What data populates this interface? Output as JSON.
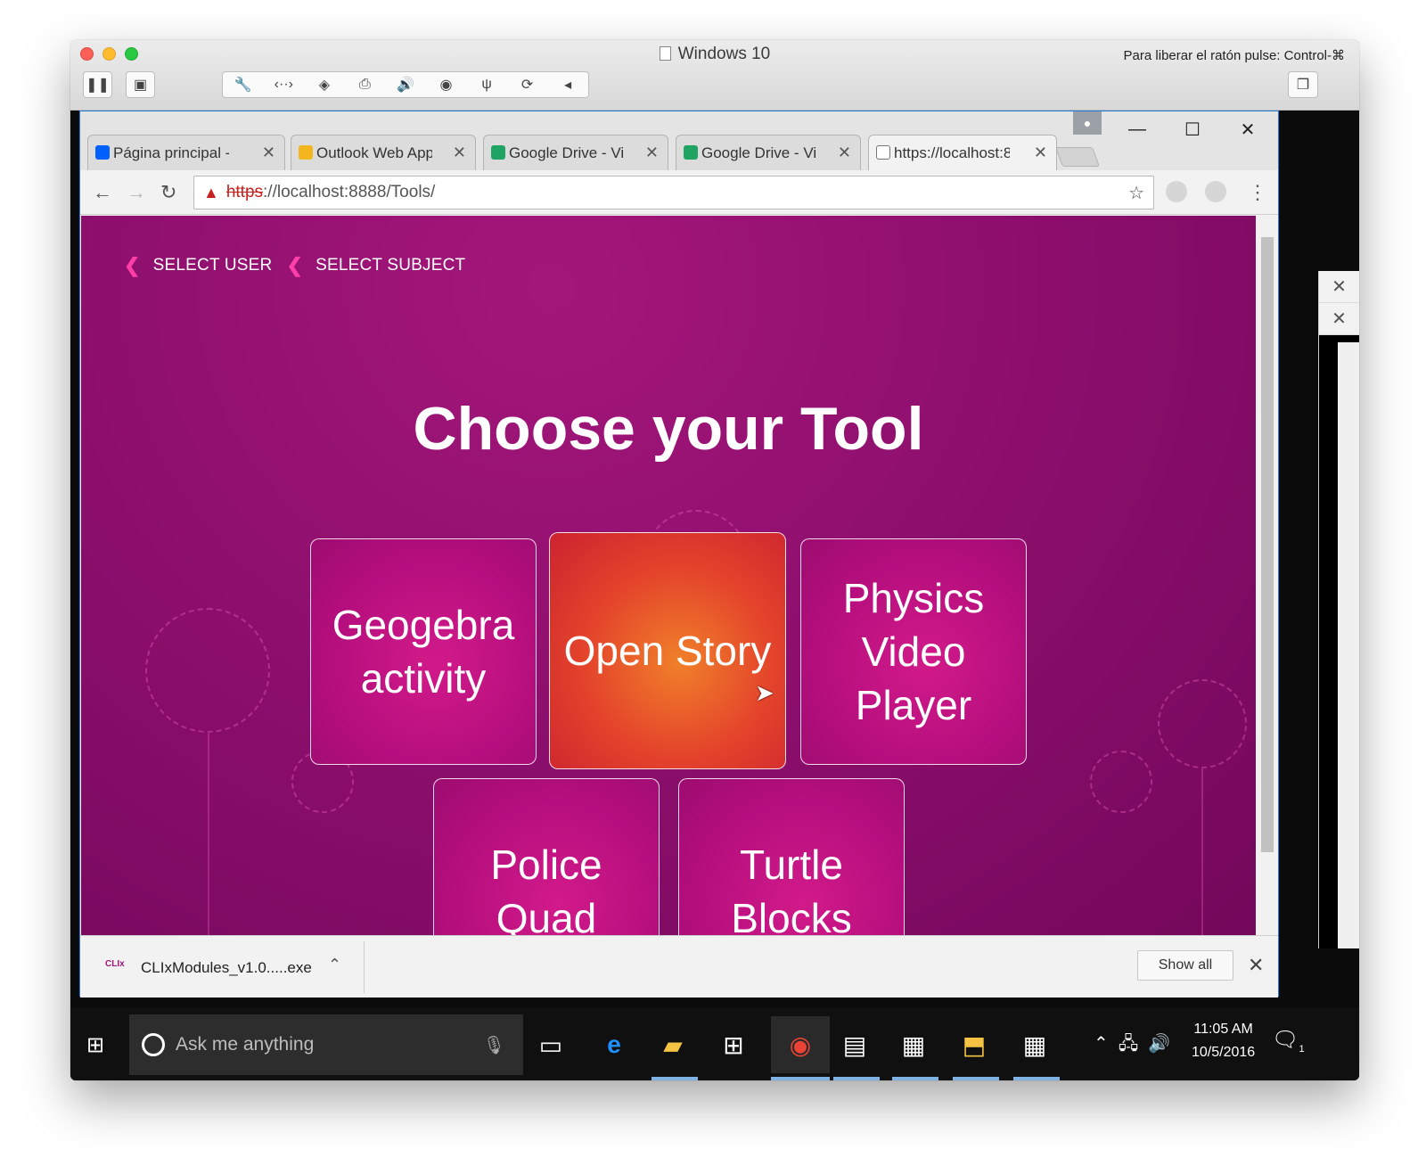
{
  "vm": {
    "title": "Windows 10",
    "hint": "Para liberar el ratón pulse: Control-⌘",
    "toolbar_icons": [
      "pause-icon",
      "snapshot-icon",
      "wrench-icon",
      "network-icon",
      "disk-icon",
      "printer-icon",
      "volume-icon",
      "camera-icon",
      "usb-icon",
      "sync-icon",
      "collapse-icon"
    ]
  },
  "browser": {
    "tabs": [
      {
        "title": "Página principal -",
        "icon": "dropbox-icon",
        "color": "#0061fe"
      },
      {
        "title": "Outlook Web App",
        "icon": "outlook-icon",
        "color": "#f3b61f"
      },
      {
        "title": "Google Drive - Vi",
        "icon": "drive-icon",
        "color": "#1fa463"
      },
      {
        "title": "Google Drive - Vi",
        "icon": "drive-icon",
        "color": "#1fa463"
      },
      {
        "title": "https://localhost:8",
        "icon": "page-icon",
        "color": "#ffffff"
      }
    ],
    "url_scheme": "https",
    "url_rest": "://localhost:8888/Tools/"
  },
  "page": {
    "breadcrumb": [
      "SELECT USER",
      "SELECT SUBJECT"
    ],
    "title": "Choose your Tool",
    "tools": [
      "Geogebra activity",
      "Open Story",
      "Physics Video Player",
      "Police Quad",
      "Turtle Blocks"
    ],
    "accent_color": "#ff3fa8",
    "background_color": "#8e0f6e"
  },
  "download": {
    "icon_label": "CLIx",
    "file": "CLIxModules_v1.0.....exe",
    "show_all": "Show all"
  },
  "taskbar": {
    "search_placeholder": "Ask me anything",
    "time": "11:05 AM",
    "date": "10/5/2016",
    "notification_count": "1"
  }
}
